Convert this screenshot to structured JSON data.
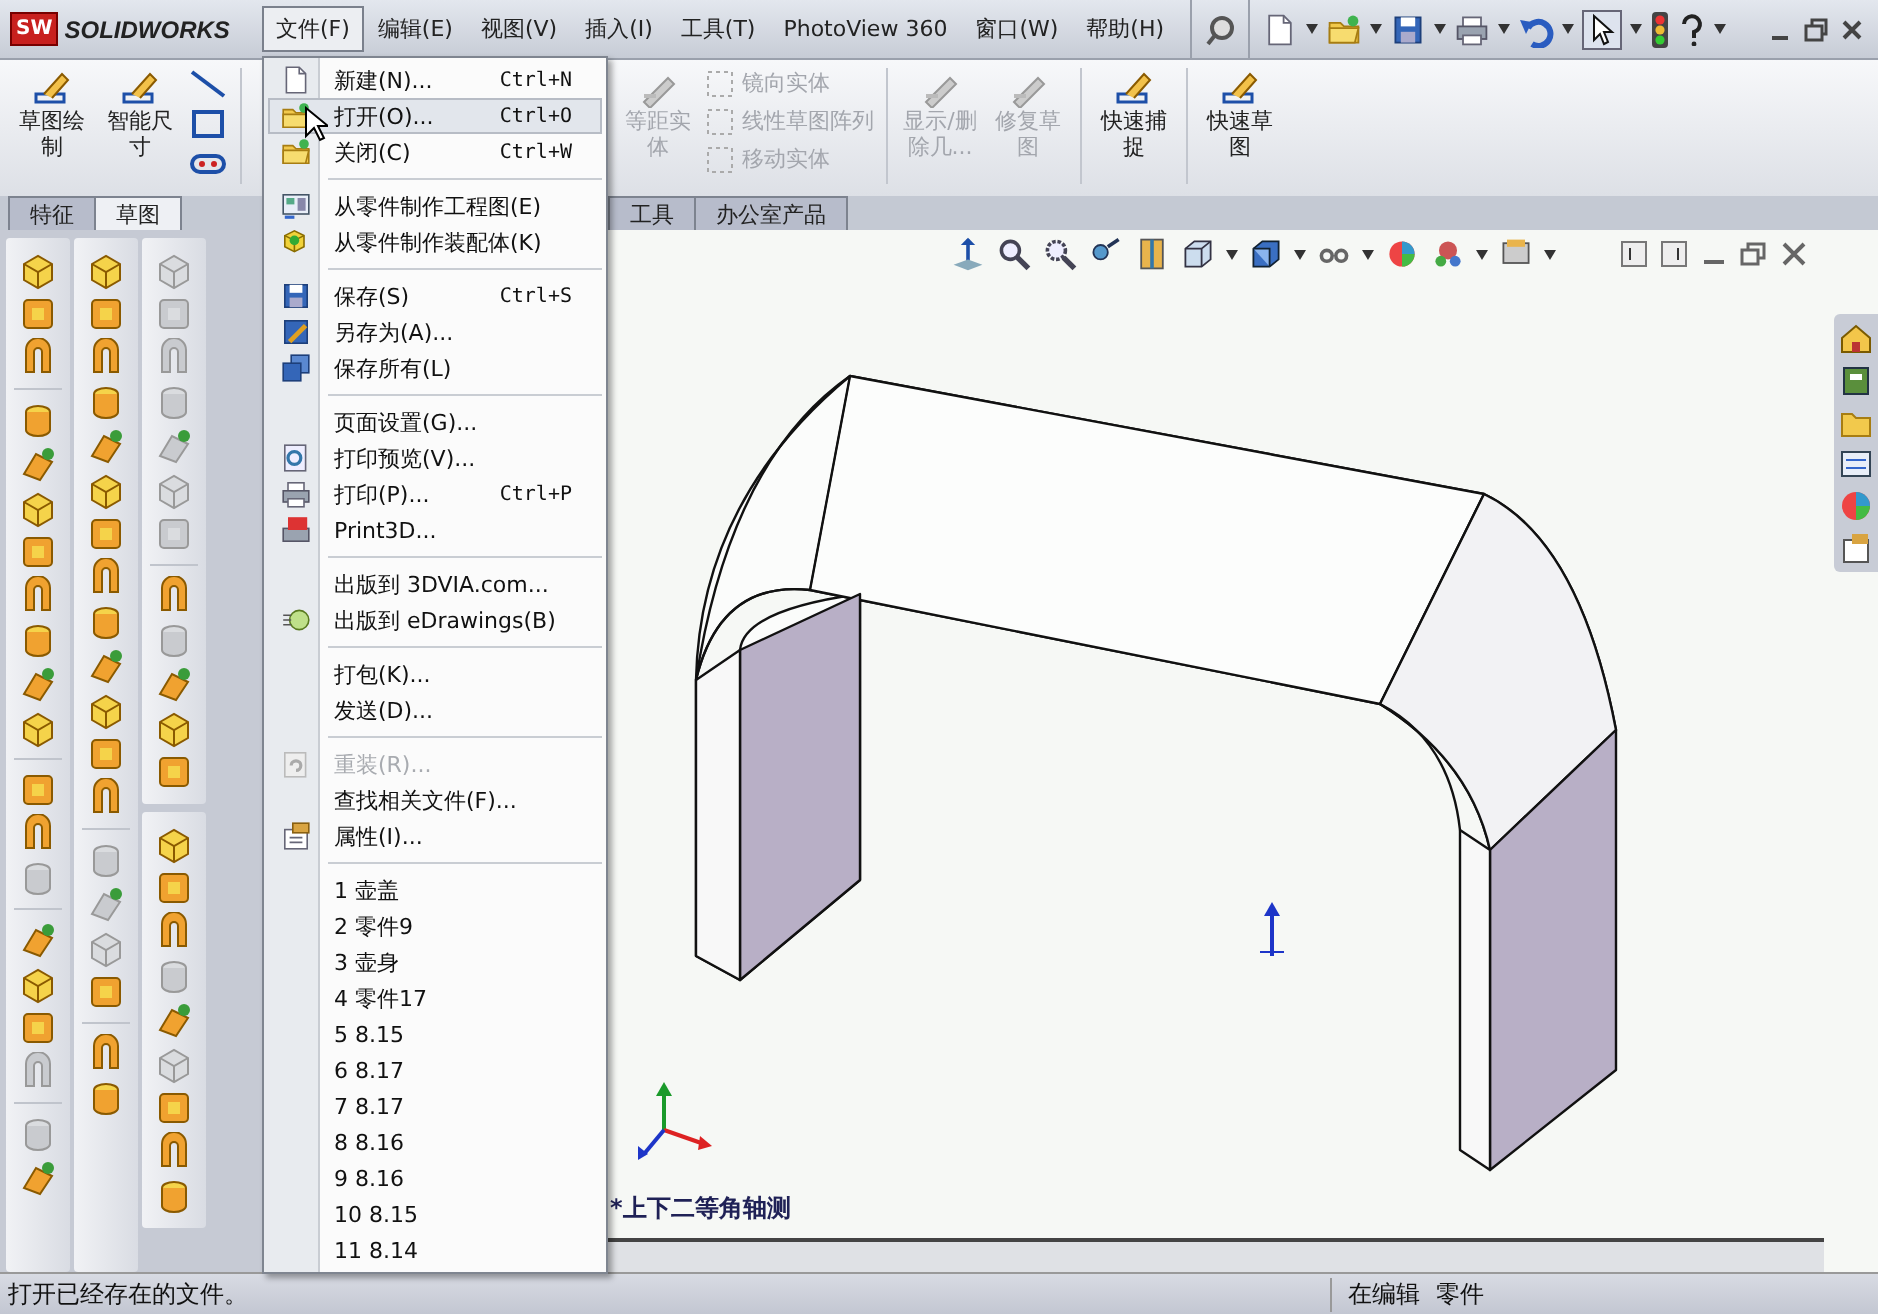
{
  "app": {
    "badge": "SW",
    "logo": "SOLIDWORKS"
  },
  "menubar": [
    {
      "label": "文件(F)",
      "selected": true
    },
    {
      "label": "编辑(E)",
      "selected": false
    },
    {
      "label": "视图(V)",
      "selected": false
    },
    {
      "label": "插入(I)",
      "selected": false
    },
    {
      "label": "工具(T)",
      "selected": false
    },
    {
      "label": "PhotoView 360",
      "selected": false
    },
    {
      "label": "窗口(W)",
      "selected": false
    },
    {
      "label": "帮助(H)",
      "selected": false
    }
  ],
  "command_groups": [
    [
      {
        "label": "草图绘制",
        "kind": "large",
        "disabled": false
      },
      {
        "label": "智能尺寸",
        "kind": "large",
        "disabled": false
      }
    ],
    [
      {
        "label": "等距实体",
        "kind": "large",
        "disabled": true
      },
      {
        "label": "镜向实体",
        "kind": "small",
        "disabled": true
      },
      {
        "label": "线性草图阵列",
        "kind": "small",
        "disabled": true
      },
      {
        "label": "移动实体",
        "kind": "small",
        "disabled": true
      }
    ],
    [
      {
        "label": "显示/删除几...",
        "kind": "large",
        "disabled": true
      },
      {
        "label": "修复草图",
        "kind": "large",
        "disabled": true
      }
    ],
    [
      {
        "label": "快速捕捉",
        "kind": "large",
        "disabled": false
      }
    ],
    [
      {
        "label": "快速草图",
        "kind": "large",
        "disabled": false
      }
    ]
  ],
  "command_tabs": [
    {
      "label": "特征",
      "selected": false
    },
    {
      "label": "草图",
      "selected": true
    },
    {
      "label": "工具",
      "selected": false
    },
    {
      "label": "办公室产品",
      "selected": false
    }
  ],
  "graphics": {
    "view_label": "*上下二等角轴测"
  },
  "file_menu": [
    {
      "kind": "item",
      "label": "新建(N)...",
      "shortcut": "Ctrl+N",
      "highlighted": false,
      "disabled": false
    },
    {
      "kind": "item",
      "label": "打开(O)...",
      "shortcut": "Ctrl+O",
      "highlighted": true,
      "disabled": false
    },
    {
      "kind": "item",
      "label": "关闭(C)",
      "shortcut": "Ctrl+W",
      "highlighted": false,
      "disabled": false
    },
    {
      "kind": "separator"
    },
    {
      "kind": "item",
      "label": "从零件制作工程图(E)",
      "highlighted": false,
      "disabled": false
    },
    {
      "kind": "item",
      "label": "从零件制作装配体(K)",
      "highlighted": false,
      "disabled": false
    },
    {
      "kind": "separator"
    },
    {
      "kind": "item",
      "label": "保存(S)",
      "shortcut": "Ctrl+S",
      "highlighted": false,
      "disabled": false
    },
    {
      "kind": "item",
      "label": "另存为(A)...",
      "highlighted": false,
      "disabled": false
    },
    {
      "kind": "item",
      "label": "保存所有(L)",
      "highlighted": false,
      "disabled": false
    },
    {
      "kind": "separator"
    },
    {
      "kind": "item",
      "label": "页面设置(G)...",
      "highlighted": false,
      "disabled": false
    },
    {
      "kind": "item",
      "label": "打印预览(V)...",
      "highlighted": false,
      "disabled": false
    },
    {
      "kind": "item",
      "label": "打印(P)...",
      "shortcut": "Ctrl+P",
      "highlighted": false,
      "disabled": false
    },
    {
      "kind": "item",
      "label": "Print3D...",
      "highlighted": false,
      "disabled": false
    },
    {
      "kind": "separator"
    },
    {
      "kind": "item",
      "label": "出版到 3DVIA.com...",
      "highlighted": false,
      "disabled": false
    },
    {
      "kind": "item",
      "label": "出版到 eDrawings(B)",
      "highlighted": false,
      "disabled": false
    },
    {
      "kind": "separator"
    },
    {
      "kind": "item",
      "label": "打包(K)...",
      "highlighted": false,
      "disabled": false
    },
    {
      "kind": "item",
      "label": "发送(D)...",
      "highlighted": false,
      "disabled": false
    },
    {
      "kind": "separator"
    },
    {
      "kind": "item",
      "label": "重装(R)...",
      "highlighted": false,
      "disabled": true
    },
    {
      "kind": "item",
      "label": "查找相关文件(F)...",
      "highlighted": false,
      "disabled": false
    },
    {
      "kind": "item",
      "label": "属性(I)...",
      "highlighted": false,
      "disabled": false
    },
    {
      "kind": "separator"
    },
    {
      "kind": "item",
      "label": "1 壶盖",
      "highlighted": false,
      "disabled": false
    },
    {
      "kind": "item",
      "label": "2 零件9",
      "highlighted": false,
      "disabled": false
    },
    {
      "kind": "item",
      "label": "3 壶身",
      "highlighted": false,
      "disabled": false
    },
    {
      "kind": "item",
      "label": "4 零件17",
      "highlighted": false,
      "disabled": false
    },
    {
      "kind": "item",
      "label": "5 8.15",
      "highlighted": false,
      "disabled": false
    },
    {
      "kind": "item",
      "label": "6 8.17",
      "highlighted": false,
      "disabled": false
    },
    {
      "kind": "item",
      "label": "7 8.17",
      "highlighted": false,
      "disabled": false
    },
    {
      "kind": "item",
      "label": "8 8.16",
      "highlighted": false,
      "disabled": false
    },
    {
      "kind": "item",
      "label": "9 8.16",
      "highlighted": false,
      "disabled": false
    },
    {
      "kind": "item",
      "label": "10 8.15",
      "highlighted": false,
      "disabled": false
    },
    {
      "kind": "item",
      "label": "11 8.14",
      "highlighted": false,
      "disabled": false
    }
  ],
  "status_bar": {
    "message": "打开已经存在的文件。",
    "mode": "在编辑",
    "doc_type": "零件"
  }
}
